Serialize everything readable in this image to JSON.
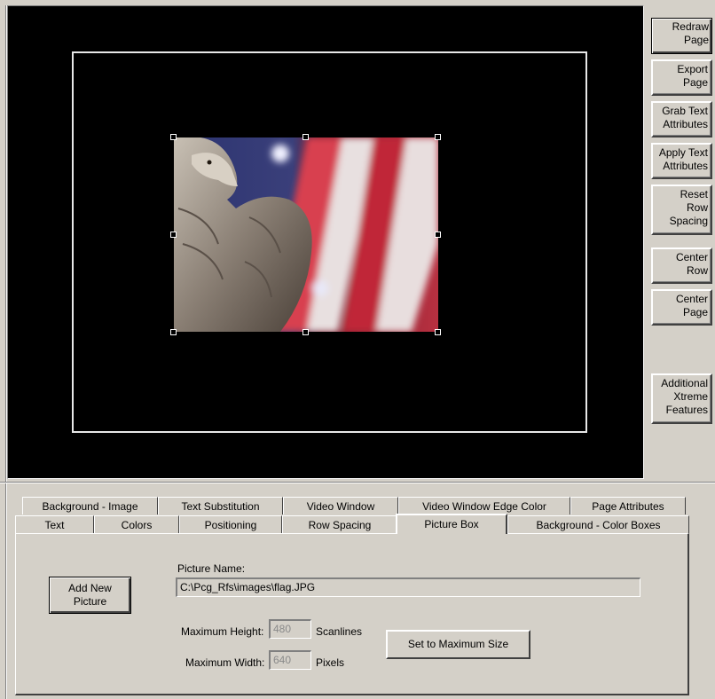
{
  "side_buttons": [
    {
      "label": "Redraw\nPage"
    },
    {
      "label": "Export\nPage"
    },
    {
      "label": "Grab Text\nAttributes"
    },
    {
      "label": "Apply Text\nAttributes"
    },
    {
      "label": "Reset\nRow\nSpacing"
    },
    {
      "label": "Center\nRow"
    },
    {
      "label": "Center\nPage"
    },
    {
      "label": "Additional\nXtreme\nFeatures"
    }
  ],
  "tabs_back": [
    "Background - Image",
    "Text Substitution",
    "Video Window",
    "Video Window Edge Color",
    "Page Attributes"
  ],
  "tabs_front": [
    "Text",
    "Colors",
    "Positioning",
    "Row Spacing",
    "Picture Box",
    "Background - Color Boxes"
  ],
  "active_tab": "Picture Box",
  "picture_box": {
    "add_button": "Add New\nPicture",
    "name_label": "Picture Name:",
    "name_value": "C:\\Pcg_Rfs\\images\\flag.JPG",
    "max_height_label": "Maximum Height:",
    "max_height_value": "480",
    "max_height_unit": "Scanlines",
    "max_width_label": "Maximum Width:",
    "max_width_value": "640",
    "max_width_unit": "Pixels",
    "set_max_button": "Set to Maximum Size"
  },
  "preview": {
    "image_subject": "eagle-and-flag-photo"
  }
}
